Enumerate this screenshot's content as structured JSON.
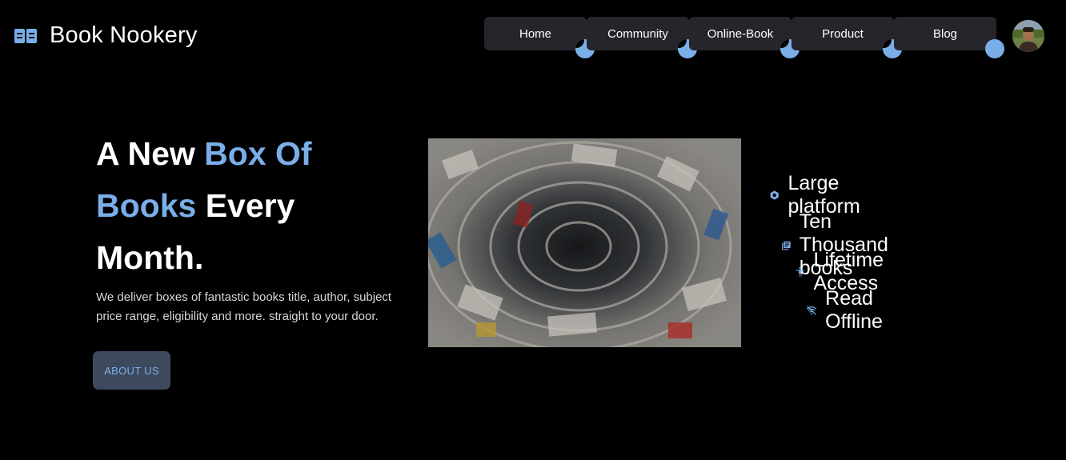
{
  "brand": {
    "title": "Book Nookery",
    "icon": "open-book-icon"
  },
  "nav": {
    "items": [
      {
        "label": "Home"
      },
      {
        "label": "Community"
      },
      {
        "label": "Online-Book"
      },
      {
        "label": "Product"
      },
      {
        "label": "Blog"
      }
    ]
  },
  "hero": {
    "title_part1": "A New ",
    "title_accent": "Box Of Books",
    "title_part2": " Every Month.",
    "description": "We deliver boxes of fantastic books title, author, subject price range, eligibility and more. straight to your door.",
    "button_label": "ABOUT US"
  },
  "features": [
    {
      "label": "Large platform",
      "icon": "hexagon-gear-icon"
    },
    {
      "label": "Ten Thousand books",
      "icon": "library-books-icon"
    },
    {
      "label": "Lifetime Access",
      "icon": "accessibility-icon"
    },
    {
      "label": "Read Offline",
      "icon": "wifi-off-icon"
    }
  ],
  "colors": {
    "accent": "#7aaee8",
    "background": "#000000",
    "nav_bg": "#25252b",
    "button_bg": "#3d4a5e"
  }
}
